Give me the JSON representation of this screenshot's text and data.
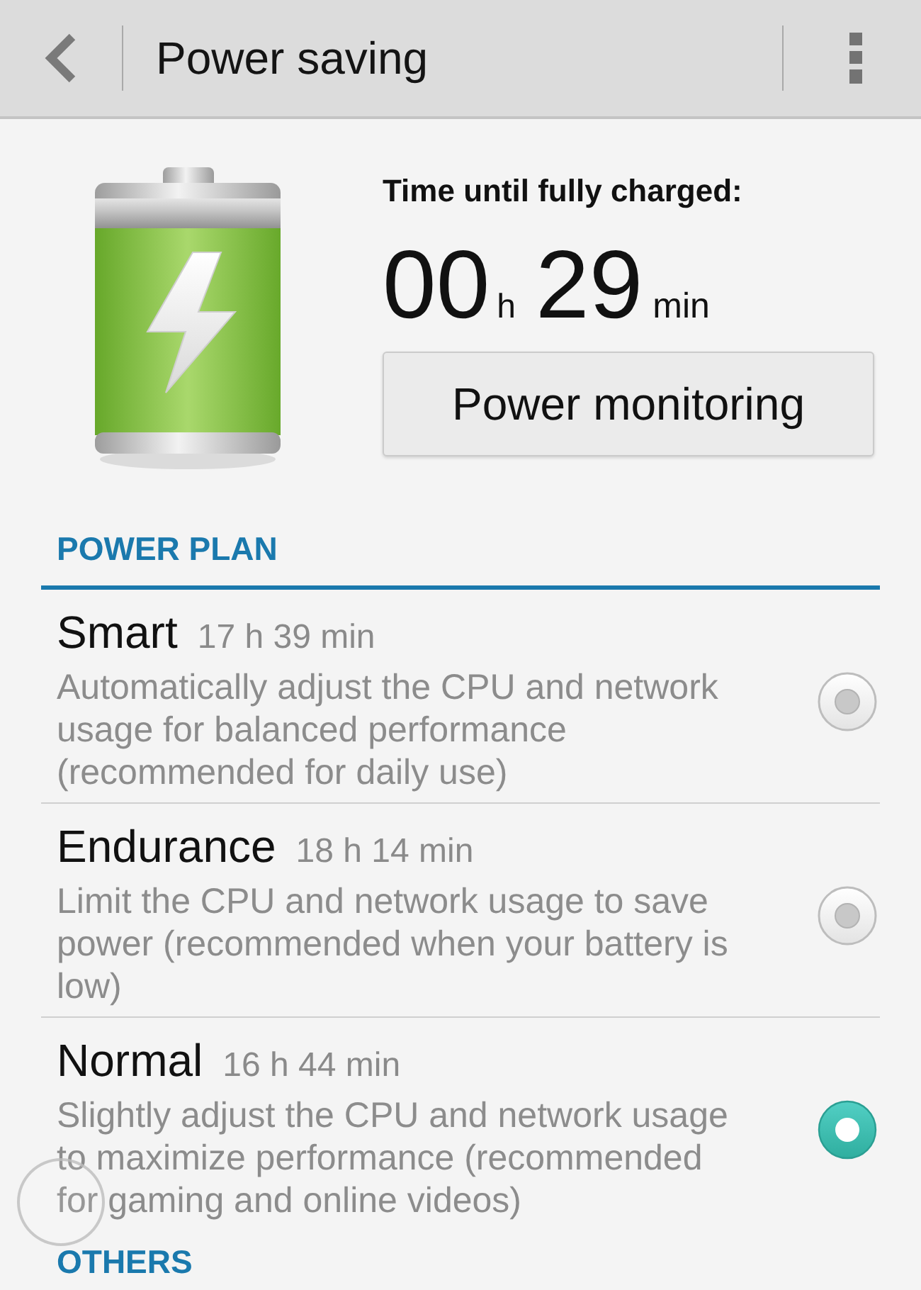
{
  "header": {
    "title": "Power saving"
  },
  "charging": {
    "label": "Time until fully charged:",
    "hours": "00",
    "hours_unit": "h",
    "minutes": "29",
    "minutes_unit": "min",
    "button": "Power monitoring"
  },
  "sections": [
    {
      "title": "POWER PLAN",
      "plans": [
        {
          "name": "Smart",
          "duration": "17 h 39 min",
          "description": "Automatically adjust the CPU and network usage for balanced performance (recommended for daily use)",
          "selected": false
        },
        {
          "name": "Endurance",
          "duration": "18 h 14 min",
          "description": "Limit the CPU and network usage to save power (recommended when your battery is low)",
          "selected": false
        },
        {
          "name": "Normal",
          "duration": "16 h 44 min",
          "description": "Slightly adjust the CPU and network usage to maximize performance (recommended for gaming and online videos)",
          "selected": true
        }
      ]
    },
    {
      "title": "OTHERS"
    }
  ]
}
